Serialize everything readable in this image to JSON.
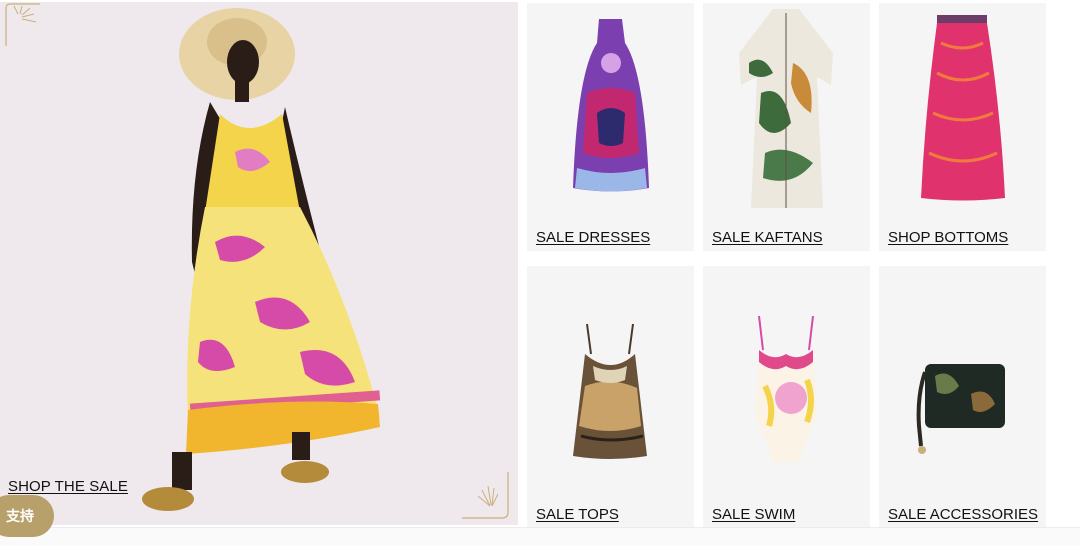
{
  "hero": {
    "cta_label": "SHOP THE SALE"
  },
  "support": {
    "label": "支持"
  },
  "tiles": [
    {
      "label": "SALE DRESSES",
      "icon": "dress-icon"
    },
    {
      "label": "SALE KAFTANS",
      "icon": "kaftan-icon"
    },
    {
      "label": "SHOP BOTTOMS",
      "icon": "skirt-icon"
    },
    {
      "label": "SALE TOPS",
      "icon": "camisole-icon"
    },
    {
      "label": "SALE SWIM",
      "icon": "swimsuit-icon"
    },
    {
      "label": "SALE ACCESSORIES",
      "icon": "pouch-icon"
    }
  ],
  "colors": {
    "hero_bg": "#efe9ed",
    "tile_bg": "#f5f5f5",
    "support_bg": "#b7a06a",
    "dress_yellow": "#f3d44b",
    "dress_pink": "#d64aa8",
    "skirt_pink": "#e0336e"
  }
}
